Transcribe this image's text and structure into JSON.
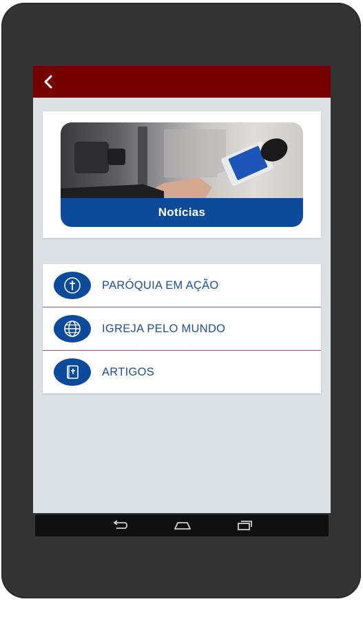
{
  "header": {
    "back_icon": "chevron-left-icon"
  },
  "news_card": {
    "caption": "Notícias"
  },
  "menu": {
    "items": [
      {
        "label": "PARÓQUIA EM AÇÃO",
        "icon": "church-cross-icon"
      },
      {
        "label": "IGREJA PELO MUNDO",
        "icon": "globe-icon"
      },
      {
        "label": "ARTIGOS",
        "icon": "bible-book-icon"
      }
    ]
  },
  "navbar": {
    "icons": [
      "back-arrow-icon",
      "home-icon",
      "recents-icon"
    ]
  },
  "colors": {
    "appbar": "#760000",
    "accent_blue": "#0d4a9a",
    "menu_text": "#1d4d98",
    "screen_bg": "#dce1e5",
    "divider": "#b05353"
  }
}
